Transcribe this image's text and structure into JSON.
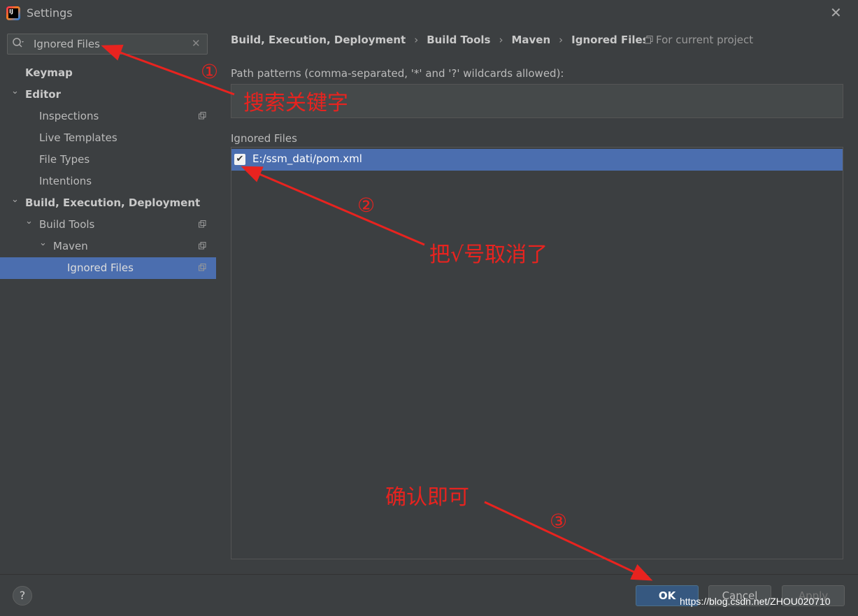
{
  "window": {
    "title": "Settings",
    "app_icon_text": "IJ"
  },
  "search": {
    "value": "Ignored Files"
  },
  "tree": [
    {
      "label": "Keymap",
      "level": 0,
      "bold": true,
      "chevron": "",
      "copy": false
    },
    {
      "label": "Editor",
      "level": 0,
      "bold": true,
      "chevron": "down",
      "copy": false
    },
    {
      "label": "Inspections",
      "level": 1,
      "bold": false,
      "chevron": "",
      "copy": true
    },
    {
      "label": "Live Templates",
      "level": 1,
      "bold": false,
      "chevron": "",
      "copy": false
    },
    {
      "label": "File Types",
      "level": 1,
      "bold": false,
      "chevron": "",
      "copy": false
    },
    {
      "label": "Intentions",
      "level": 1,
      "bold": false,
      "chevron": "",
      "copy": false
    },
    {
      "label": "Build, Execution, Deployment",
      "level": 0,
      "bold": true,
      "chevron": "down",
      "copy": false
    },
    {
      "label": "Build Tools",
      "level": 1,
      "bold": false,
      "chevron": "down",
      "copy": true
    },
    {
      "label": "Maven",
      "level": 2,
      "bold": false,
      "chevron": "down",
      "copy": true
    },
    {
      "label": "Ignored Files",
      "level": 3,
      "bold": false,
      "chevron": "",
      "copy": true,
      "selected": true
    }
  ],
  "breadcrumb": [
    "Build, Execution, Deployment",
    "Build Tools",
    "Maven",
    "Ignored Files"
  ],
  "scope": {
    "label": "For current project"
  },
  "path_patterns": {
    "label": "Path patterns (comma-separated, '*' and '?' wildcards allowed):",
    "value": ""
  },
  "ignored_files": {
    "label": "Ignored Files",
    "items": [
      {
        "path": "E:/ssm_dati/pom.xml",
        "checked": true
      }
    ]
  },
  "buttons": {
    "help": "?",
    "ok": "OK",
    "cancel": "Cancel",
    "apply": "Apply"
  },
  "annotations": {
    "step1_num": "①",
    "step1_text": "搜索关键字",
    "step2_num": "②",
    "step2_text": "把√号取消了",
    "step3_num": "③",
    "step3_text": "确认即可",
    "color": "#e8231f"
  },
  "watermark": "https://blog.csdn.net/ZHOU020710",
  "colors": {
    "background": "#3c3f41",
    "selection": "#4b6eaf",
    "ok_button": "#365880"
  }
}
